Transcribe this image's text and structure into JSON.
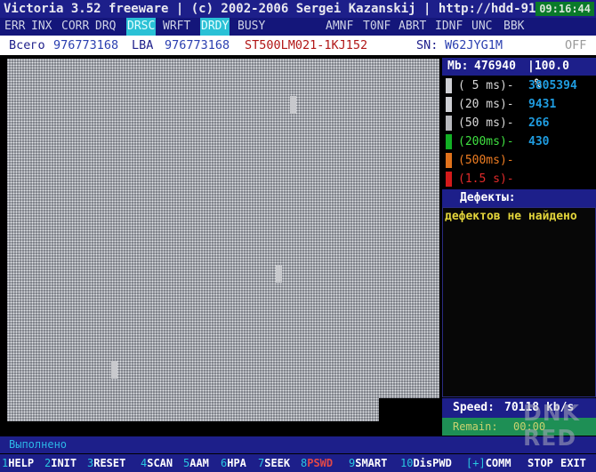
{
  "title": {
    "text": "Victoria 3.52 freeware | (c) 2002-2006  Sergei Kazanskij  | http://hdd-911.com",
    "clock": "09:16:44"
  },
  "flags": [
    {
      "label": "ERR",
      "active": false
    },
    {
      "label": "INX",
      "active": false
    },
    {
      "label": "CORR",
      "active": false
    },
    {
      "label": "DRQ",
      "active": false
    },
    {
      "label": "DRSC",
      "active": true
    },
    {
      "label": "WRFT",
      "active": false
    },
    {
      "label": "DRDY",
      "active": true
    },
    {
      "label": "BUSY",
      "active": false
    },
    {
      "label": "AMNF",
      "active": false
    },
    {
      "label": "T0NF",
      "active": false
    },
    {
      "label": "ABRT",
      "active": false
    },
    {
      "label": "IDNF",
      "active": false
    },
    {
      "label": "UNC",
      "active": false
    },
    {
      "label": "BBK",
      "active": false
    }
  ],
  "info": {
    "total_label": "Всего",
    "total_value": "976773168",
    "lba_label": "LBA",
    "lba_value": "976773168",
    "model": "ST500LM021-1KJ152",
    "sn_label": "SN:",
    "sn_value": "W62JYG1M",
    "off_label": "OFF"
  },
  "progress": {
    "mb_label": "Mb:",
    "mb_value": "476940",
    "percent": "100.0 %",
    "fraction": 1.0
  },
  "access_stats": [
    {
      "label": "( 5 ms)-",
      "value": "3805394",
      "color": "#cfd0d4",
      "text_color": "#d8d8d8"
    },
    {
      "label": "(20 ms)-",
      "value": "9431",
      "color": "#cfd0d4",
      "text_color": "#d8d8d8"
    },
    {
      "label": "(50 ms)-",
      "value": "266",
      "color": "#b8b9bd",
      "text_color": "#d8d8d8"
    },
    {
      "label": "(200ms)-",
      "value": "430",
      "color": "#13b025",
      "text_color": "#3fe040"
    },
    {
      "label": "(500ms)-",
      "value": "",
      "color": "#e0721c",
      "text_color": "#ef7d22"
    },
    {
      "label": "(1.5 s)-",
      "value": "",
      "color": "#d41a1a",
      "text_color": "#e22a2a"
    }
  ],
  "defects": {
    "title": "Дефекты:",
    "message": "дефектов не найдено"
  },
  "speed": {
    "label": "Speed:",
    "value": "70118 kb/s"
  },
  "remain": {
    "label": "Remain:",
    "value": "00:00"
  },
  "status": {
    "text": "Выполнено"
  },
  "fkeys": [
    {
      "num": "1",
      "label": "HELP",
      "red": false
    },
    {
      "num": "2",
      "label": "INIT",
      "red": false
    },
    {
      "num": "3",
      "label": "RESET",
      "red": false
    },
    {
      "num": "4",
      "label": "SCAN",
      "red": false
    },
    {
      "num": "5",
      "label": "AAM",
      "red": false
    },
    {
      "num": "6",
      "label": "HPA",
      "red": false
    },
    {
      "num": "7",
      "label": "SEEK",
      "red": false
    },
    {
      "num": "8",
      "label": "PSWD",
      "red": true
    },
    {
      "num": "9",
      "label": "SMART",
      "red": false
    },
    {
      "num": "10",
      "label": "DisPWD",
      "red": false
    },
    {
      "num": "[+]",
      "label": "COMM",
      "red": false
    },
    {
      "num": "",
      "label": "STOP",
      "red": false
    },
    {
      "num": "",
      "label": "EXIT",
      "red": false
    }
  ],
  "watermark": {
    "line1": "DNK",
    "line2": "RED"
  }
}
